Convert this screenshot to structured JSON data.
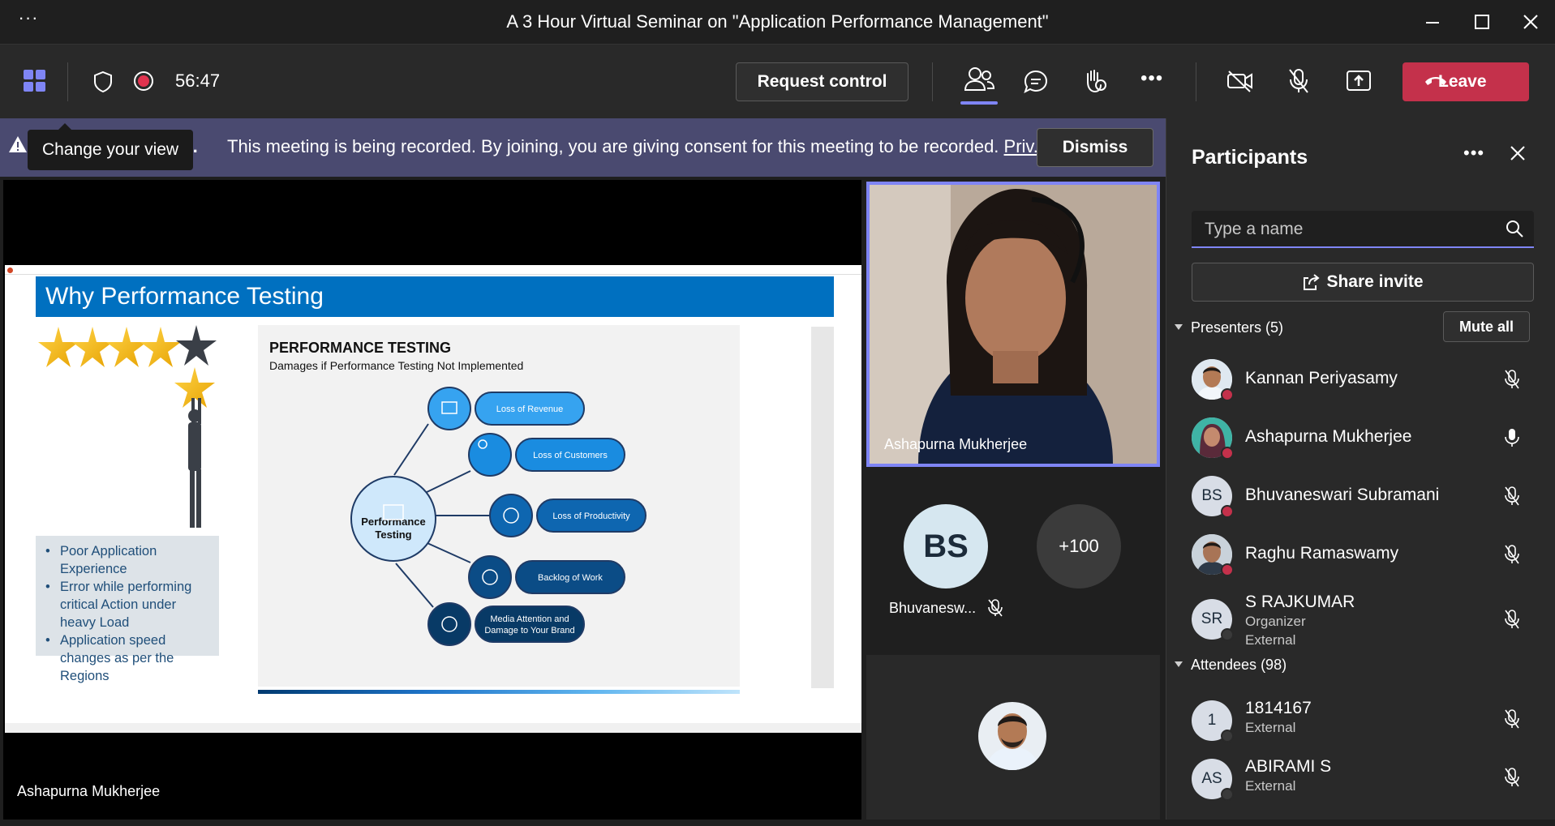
{
  "window": {
    "title": "A 3 Hour Virtual Seminar on \"Application Performance Management\"",
    "more_glyph": "···"
  },
  "toolbar": {
    "timer": "56:47",
    "request_control": "Request control",
    "more_glyph": "•••",
    "leave": "Leave",
    "accent_color": "#7f85f5",
    "leave_color": "#c4314b"
  },
  "banner": {
    "partial_text": "ed.",
    "message": "This meeting is being recorded. By joining, you are giving consent for this meeting to be recorded.",
    "link": "Priv...",
    "dismiss": "Dismiss",
    "tooltip": "Change your view"
  },
  "stage": {
    "presenter_name": "Ashapurna Mukherjee",
    "slide": {
      "title": "Why Performance Testing",
      "heading": "PERFORMANCE TESTING",
      "subheading": "Damages if Performance Testing Not Implemented",
      "center_node": [
        "Performance",
        "Testing"
      ],
      "outcomes": [
        "Loss of Revenue",
        "Loss of Customers",
        "Loss of Productivity",
        "Backlog of Work",
        "Media Attention and",
        "Damage to Your Brand"
      ],
      "bullets": [
        "Poor Application Experience",
        "Error while performing critical Action under heavy Load",
        "Application speed changes as per the Regions"
      ]
    }
  },
  "videos": {
    "main_name": "Ashapurna Mukherjee",
    "bs_initials": "BS",
    "bs_name": "Bhuvanesw...",
    "more_count": "+100"
  },
  "participants": {
    "title": "Participants",
    "more_glyph": "•••",
    "search_placeholder": "Type a name",
    "share_invite": "Share invite",
    "presenters_label": "Presenters (5)",
    "mute_all": "Mute all",
    "attendees_label": "Attendees (98)",
    "presenters": [
      {
        "name": "Kannan Periyasamy"
      },
      {
        "name": "Ashapurna Mukherjee"
      },
      {
        "name": "Bhuvaneswari Subramani",
        "initials": "BS"
      },
      {
        "name": "Raghu Ramaswamy"
      },
      {
        "name": "S RAJKUMAR",
        "initials": "SR",
        "role": "Organizer",
        "external": "External"
      }
    ],
    "attendees": [
      {
        "name": "1814167",
        "initials": "1",
        "external": "External"
      },
      {
        "name": "ABIRAMI S",
        "initials": "AS",
        "external": "External"
      }
    ]
  }
}
